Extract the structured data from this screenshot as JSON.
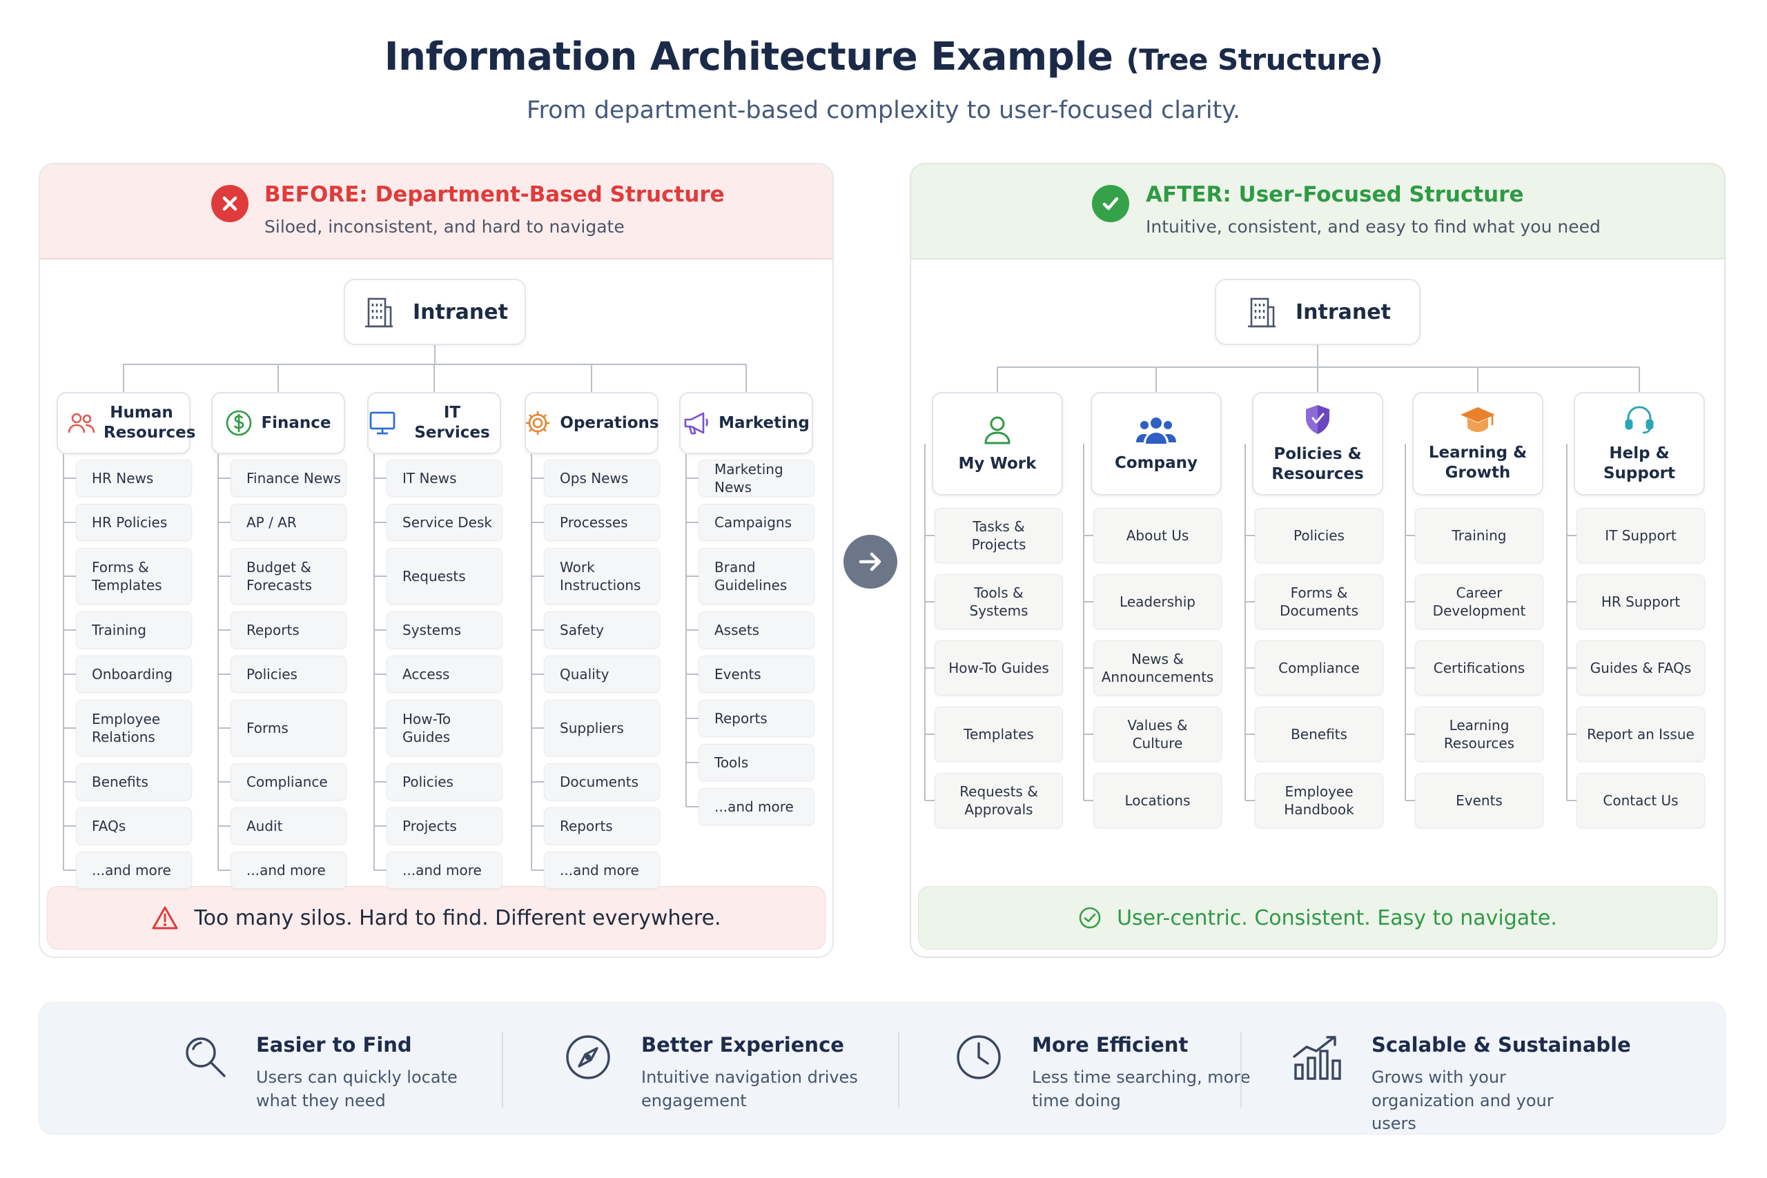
{
  "title": "Information Architecture Example",
  "title_suffix": "(Tree Structure)",
  "subtitle": "From department-based complexity to user-focused clarity.",
  "before": {
    "heading": "BEFORE: Department-Based Structure",
    "subheading": "Siloed, inconsistent, and hard to navigate",
    "root": "Intranet",
    "columns": [
      {
        "label": "Human Resources",
        "icon": "people-icon",
        "items": [
          "HR News",
          "HR Policies",
          "Forms & Templates",
          "Training",
          "Onboarding",
          "Employee Relations",
          "Benefits",
          "FAQs",
          "...and more"
        ]
      },
      {
        "label": "Finance",
        "icon": "dollar-icon",
        "items": [
          "Finance News",
          "AP / AR",
          "Budget & Forecasts",
          "Reports",
          "Policies",
          "Forms",
          "Compliance",
          "Audit",
          "...and more"
        ]
      },
      {
        "label": "IT Services",
        "icon": "monitor-icon",
        "items": [
          "IT News",
          "Service Desk",
          "Requests",
          "Systems",
          "Access",
          "How-To Guides",
          "Policies",
          "Projects",
          "...and more"
        ]
      },
      {
        "label": "Operations",
        "icon": "gear-icon",
        "items": [
          "Ops News",
          "Processes",
          "Work Instructions",
          "Safety",
          "Quality",
          "Suppliers",
          "Documents",
          "Reports",
          "...and more"
        ]
      },
      {
        "label": "Marketing",
        "icon": "megaphone-icon",
        "items": [
          "Marketing News",
          "Campaigns",
          "Brand Guidelines",
          "Assets",
          "Events",
          "Reports",
          "Tools",
          "...and more"
        ]
      }
    ],
    "footer": "Too many silos. Hard to find. Different everywhere."
  },
  "after": {
    "heading": "AFTER: User-Focused Structure",
    "subheading": "Intuitive, consistent, and easy to find what you need",
    "root": "Intranet",
    "columns": [
      {
        "label": "My Work",
        "icon": "user-icon",
        "items": [
          "Tasks & Projects",
          "Tools & Systems",
          "How-To Guides",
          "Templates",
          "Requests & Approvals"
        ]
      },
      {
        "label": "Company",
        "icon": "group-icon",
        "items": [
          "About Us",
          "Leadership",
          "News & Announcements",
          "Values & Culture",
          "Locations"
        ]
      },
      {
        "label": "Policies & Resources",
        "icon": "shield-icon",
        "items": [
          "Policies",
          "Forms & Documents",
          "Compliance",
          "Benefits",
          "Employee Handbook"
        ]
      },
      {
        "label": "Learning & Growth",
        "icon": "graduation-cap-icon",
        "items": [
          "Training",
          "Career Development",
          "Certifications",
          "Learning Resources",
          "Events"
        ]
      },
      {
        "label": "Help & Support",
        "icon": "headset-icon",
        "items": [
          "IT Support",
          "HR Support",
          "Guides & FAQs",
          "Report an Issue",
          "Contact Us"
        ]
      }
    ],
    "footer": "User-centric. Consistent. Easy to navigate."
  },
  "benefits": [
    {
      "title": "Easier to Find",
      "desc": "Users can quickly locate what they need",
      "icon": "search-icon"
    },
    {
      "title": "Better Experience",
      "desc": "Intuitive navigation drives engagement",
      "icon": "compass-icon"
    },
    {
      "title": "More Efficient",
      "desc": "Less time searching, more time doing",
      "icon": "clock-icon"
    },
    {
      "title": "Scalable & Sustainable",
      "desc": "Grows with your organization and your users",
      "icon": "growth-chart-icon"
    }
  ],
  "colors": {
    "before_accent": "#e03b3b",
    "after_accent": "#35a148",
    "navy": "#1b2a48",
    "arrow": "#6b7689"
  }
}
